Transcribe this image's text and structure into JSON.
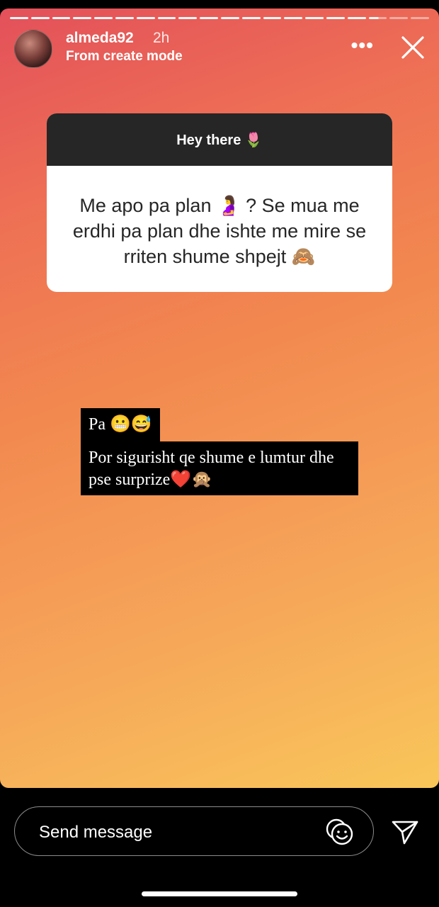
{
  "header": {
    "username": "almeda92",
    "time_ago": "2h",
    "subtitle": "From create mode",
    "more_label": "•••"
  },
  "progress": {
    "segments": 20,
    "completed": 17,
    "current_fill": 0.55
  },
  "question_card": {
    "prompt": "Hey there 🌷",
    "answer": "Me apo pa plan 🤰 ? Se mua me erdhi pa plan dhe ishte me mire se rriten shume shpejt 🙈"
  },
  "caption": {
    "line1": "Pa 😬😅",
    "line2": "Por sigurisht qe shume e lumtur dhe pse surprize❤️🙊"
  },
  "reply_bar": {
    "placeholder": "Send message"
  },
  "icons": {
    "more": "more-options-icon",
    "close": "close-icon",
    "sticker": "sticker-reaction-icon",
    "send": "send-paper-plane-icon"
  }
}
